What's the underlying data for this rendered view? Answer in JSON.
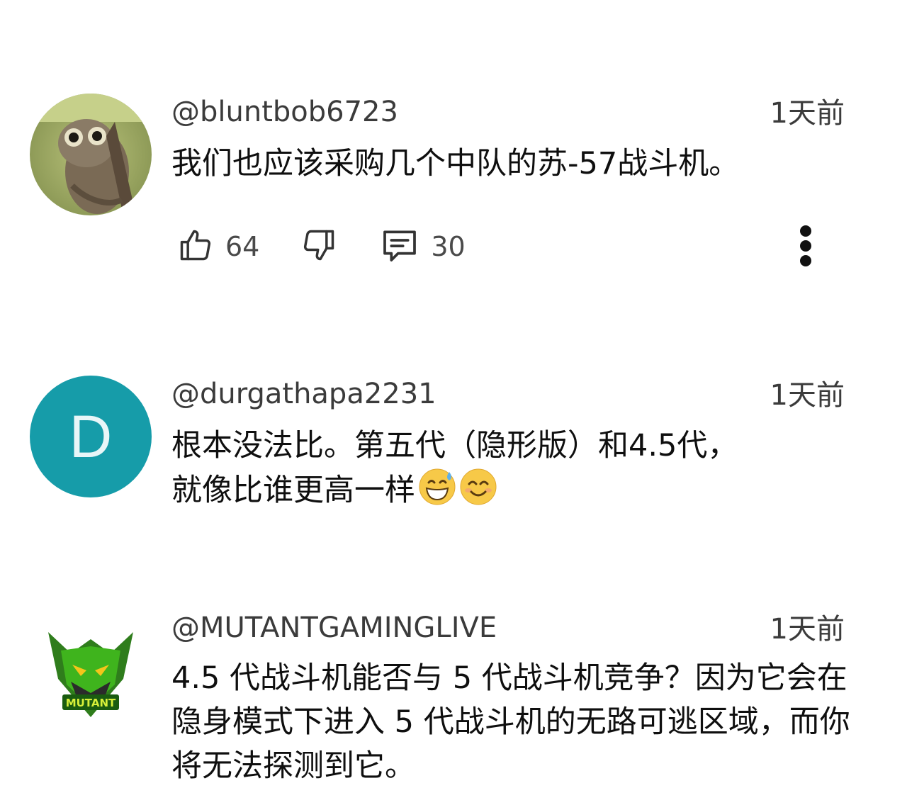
{
  "comments": [
    {
      "handle": "@bluntbob6723",
      "time": "1天前",
      "text": "我们也应该采购几个中队的苏-57战斗机。",
      "likes": "64",
      "replies": "30",
      "avatar_icon": "tarsier-photo"
    },
    {
      "handle": "@durgathapa2231",
      "time": "1天前",
      "text_line1": "根本没法比。第五代（隐形版）和4.5代，",
      "text_line2": "就像比谁更高一样",
      "avatar_letter": "D",
      "avatar_color": "#169ca9",
      "emojis": [
        "grinning-face-with-sweat",
        "smiling-face-with-smiling-eyes"
      ]
    },
    {
      "handle": "@MUTANTGAMINGLIVE",
      "time": "1天前",
      "text": "4.5 代战斗机能否与 5 代战斗机竞争？因为它会在隐身模式下进入 5 代战斗机的无路可逃区域，而你将无法探测到它。",
      "avatar_icon": "mutant-gaming-logo",
      "avatar_text": "MUTANT"
    }
  ],
  "icons": {
    "like": "thumbs-up-icon",
    "dislike": "thumbs-down-icon",
    "reply": "comment-icon",
    "more": "more-vertical-icon"
  }
}
